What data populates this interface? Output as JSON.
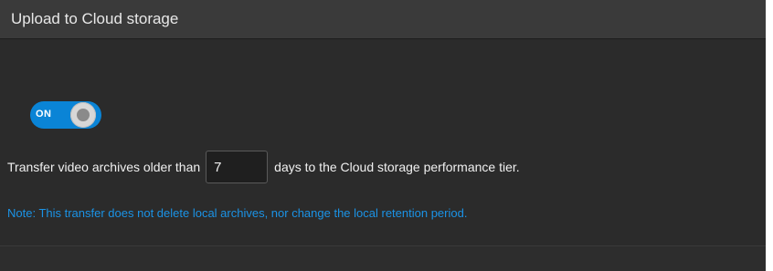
{
  "panel": {
    "title": "Upload to Cloud storage"
  },
  "toggle": {
    "label": "ON",
    "state": "on"
  },
  "transfer": {
    "prefix": "Transfer video archives older than",
    "days_value": "7",
    "suffix": "days to the Cloud storage performance tier."
  },
  "note": "Note: This transfer does not delete local archives, nor change the local retention period.",
  "colors": {
    "accent": "#0a84d6",
    "note_text": "#1b93e6",
    "panel_bg": "#2b2b2b",
    "header_bg": "#3a3a3a"
  }
}
